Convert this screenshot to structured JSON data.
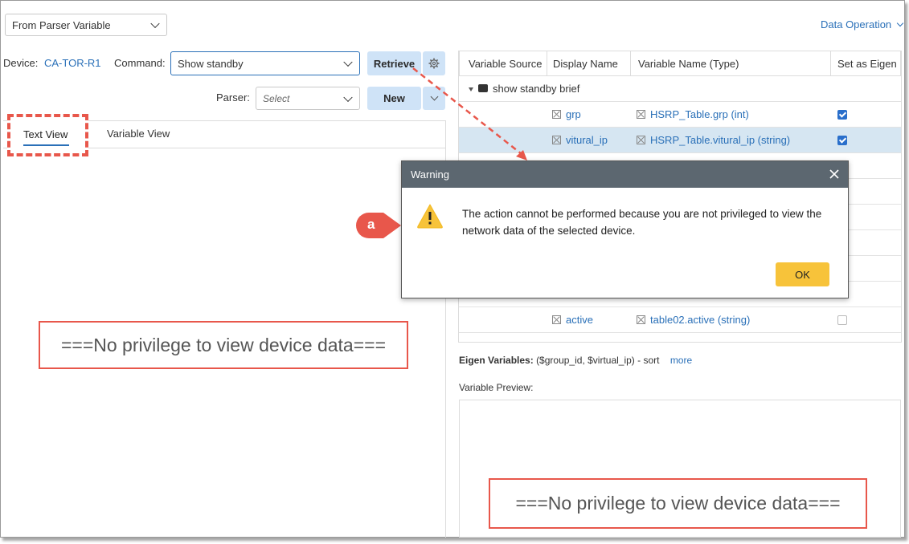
{
  "source_select": {
    "value": "From Parser Variable"
  },
  "data_operation": {
    "label": "Data Operation"
  },
  "device": {
    "label": "Device:",
    "value": "CA-TOR-R1"
  },
  "command": {
    "label": "Command:",
    "value": "Show standby"
  },
  "retrieve_button": {
    "label": "Retrieve"
  },
  "parser": {
    "label": "Parser:",
    "placeholder": "Select"
  },
  "new_button": {
    "label": "New"
  },
  "tabs": [
    {
      "label": "Text View",
      "active": true
    },
    {
      "label": "Variable View",
      "active": false
    }
  ],
  "no_privilege_text": "===No privilege to view device data===",
  "table": {
    "columns": [
      "Variable Source",
      "Display Name",
      "Variable Name (Type)",
      "Set as Eigen"
    ],
    "group": {
      "label": "show standby brief",
      "badge": "CLI"
    },
    "rows": [
      {
        "display": "grp",
        "variable": "HSRP_Table.grp (int)",
        "eigen": true
      },
      {
        "display": "vitural_ip",
        "variable": "HSRP_Table.vitural_ip (string)",
        "eigen": true
      },
      {
        "display": "active",
        "variable": "table02.active (string)",
        "eigen": false
      }
    ]
  },
  "eigen_variables": {
    "label": "Eigen Variables:",
    "value": "($group_id, $virtual_ip) - sort",
    "more": "more"
  },
  "variable_preview": {
    "label": "Variable Preview:"
  },
  "warning_dialog": {
    "title": "Warning",
    "message": "The action cannot be performed because you are not privileged to view the network data of the selected device.",
    "ok_label": "OK"
  },
  "callout": {
    "label": "a"
  },
  "colors": {
    "accent": "#2a70b8",
    "callout_red": "#e8574b",
    "dialog_header": "#5c6770",
    "ok_button": "#f7c33a",
    "selected_row": "#d6e6f2"
  }
}
